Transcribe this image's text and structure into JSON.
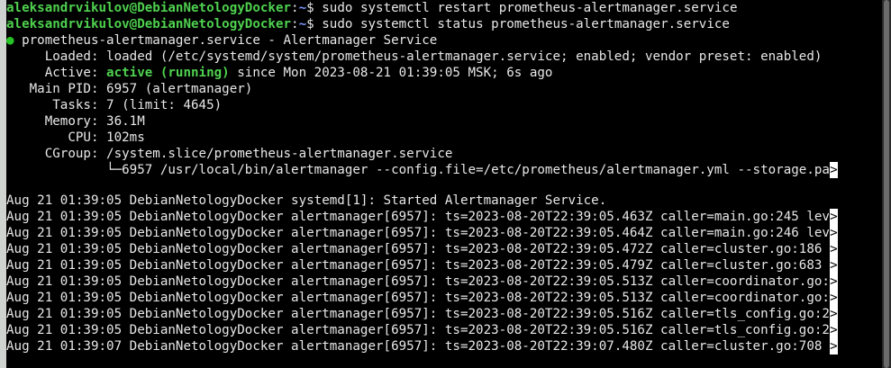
{
  "terminal": {
    "prompt_user_host": "aleksandrvikulov@DebianNetologyDocker",
    "prompt_sep": ":",
    "prompt_path": "~",
    "prompt_symbol": "$",
    "cmd1": "sudo systemctl restart prometheus-alertmanager.service",
    "cmd2": "sudo systemctl status prometheus-alertmanager.service",
    "status": {
      "bullet": "●",
      "title": "prometheus-alertmanager.service - Alertmanager Service",
      "loaded_label": "     Loaded:",
      "loaded_value": "loaded (/etc/systemd/system/prometheus-alertmanager.service; enabled; vendor preset: enabled)",
      "active_label": "     Active:",
      "active_state": "active (running)",
      "active_since": "since Mon 2023-08-21 01:39:05 MSK; 6s ago",
      "mainpid_label": "   Main PID:",
      "mainpid_value": "6957 (alertmanager)",
      "tasks_label": "      Tasks:",
      "tasks_value": "7 (limit: 4645)",
      "memory_label": "     Memory:",
      "memory_value": "36.1M",
      "cpu_label": "        CPU:",
      "cpu_value": "102ms",
      "cgroup_label": "     CGroup:",
      "cgroup_value": "/system.slice/prometheus-alertmanager.service",
      "cgroup_tree": "             └─6957 /usr/local/bin/alertmanager --config.file=/etc/prometheus/alertmanager.yml --storage.pa"
    },
    "truncation_marker": ">",
    "log_lines": [
      "Aug 21 01:39:05 DebianNetologyDocker systemd[1]: Started Alertmanager Service.",
      "Aug 21 01:39:05 DebianNetologyDocker alertmanager[6957]: ts=2023-08-20T22:39:05.463Z caller=main.go:245 lev",
      "Aug 21 01:39:05 DebianNetologyDocker alertmanager[6957]: ts=2023-08-20T22:39:05.464Z caller=main.go:246 lev",
      "Aug 21 01:39:05 DebianNetologyDocker alertmanager[6957]: ts=2023-08-20T22:39:05.472Z caller=cluster.go:186 ",
      "Aug 21 01:39:05 DebianNetologyDocker alertmanager[6957]: ts=2023-08-20T22:39:05.479Z caller=cluster.go:683 ",
      "Aug 21 01:39:05 DebianNetologyDocker alertmanager[6957]: ts=2023-08-20T22:39:05.513Z caller=coordinator.go:",
      "Aug 21 01:39:05 DebianNetologyDocker alertmanager[6957]: ts=2023-08-20T22:39:05.513Z caller=coordinator.go:",
      "Aug 21 01:39:05 DebianNetologyDocker alertmanager[6957]: ts=2023-08-20T22:39:05.516Z caller=tls_config.go:2",
      "Aug 21 01:39:05 DebianNetologyDocker alertmanager[6957]: ts=2023-08-20T22:39:05.516Z caller=tls_config.go:2",
      "Aug 21 01:39:07 DebianNetologyDocker alertmanager[6957]: ts=2023-08-20T22:39:07.480Z caller=cluster.go:708 "
    ]
  },
  "colors": {
    "background": "#000000",
    "foreground": "#e8e8e8",
    "prompt_user": "#4fd14f",
    "prompt_path": "#7e99ff",
    "active_running": "#4fd14f",
    "bullet": "#26c426"
  }
}
